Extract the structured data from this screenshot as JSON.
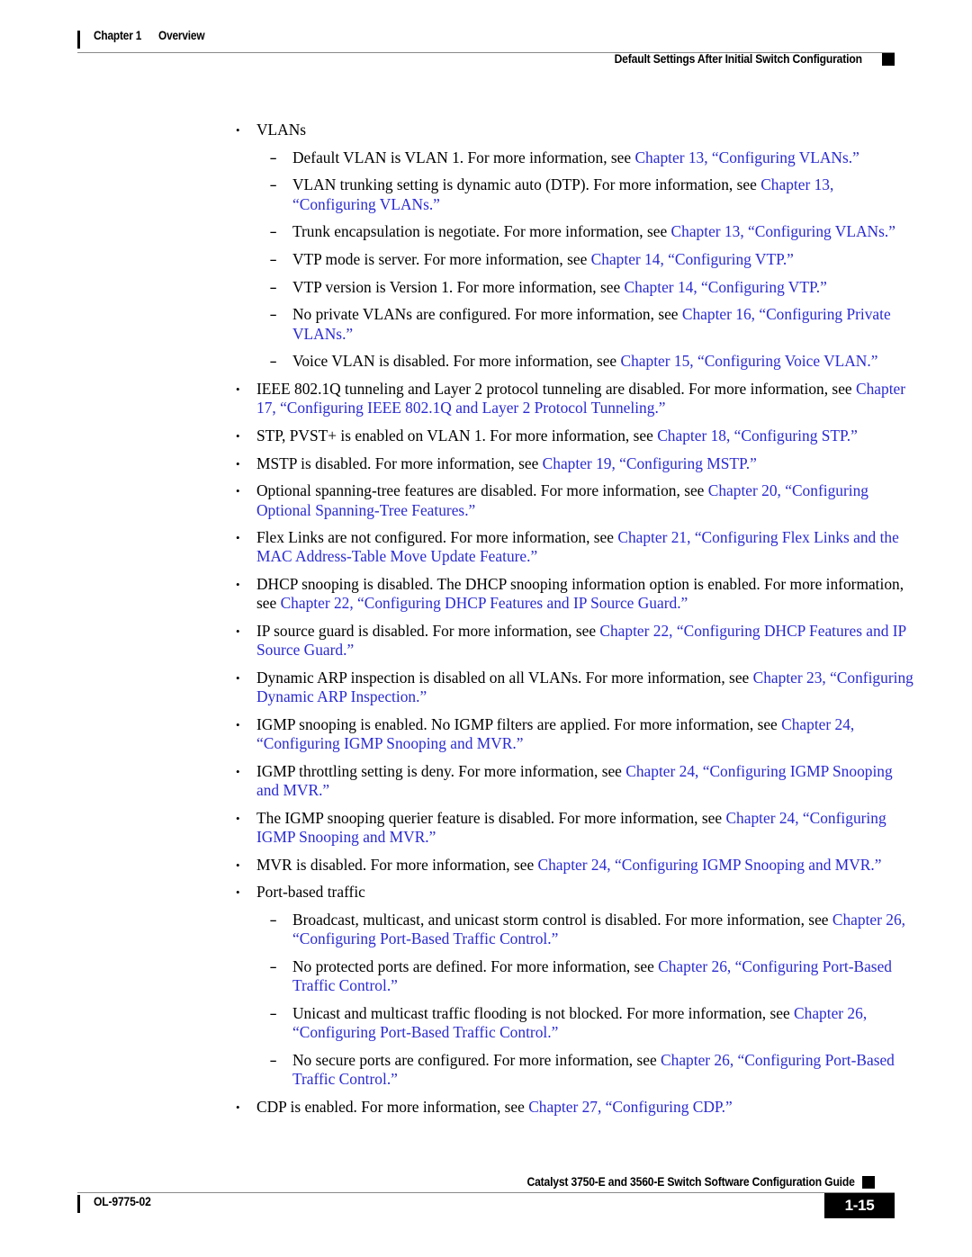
{
  "header": {
    "chapter": "Chapter 1",
    "chapter_title": "Overview",
    "section": "Default Settings After Initial Switch Configuration"
  },
  "footer": {
    "guide_title": "Catalyst 3750-E and 3560-E Switch Software Configuration Guide",
    "doc_id": "OL-9775-02",
    "page_number": "1-15"
  },
  "colors": {
    "link": "#2a2ad0",
    "text": "#000000",
    "rule": "#8a8a8a"
  },
  "markers": {
    "bullet_level1": "•",
    "bullet_level2": "–"
  },
  "body": {
    "items": [
      {
        "level": 1,
        "segments": [
          {
            "text": "VLANs",
            "link": false
          }
        ]
      },
      {
        "level": 2,
        "segments": [
          {
            "text": "Default VLAN is VLAN 1. For more information, see ",
            "link": false
          },
          {
            "text": "Chapter 13, “Configuring VLANs.”",
            "link": true
          }
        ]
      },
      {
        "level": 2,
        "segments": [
          {
            "text": "VLAN trunking setting is dynamic auto (DTP). For more information, see ",
            "link": false
          },
          {
            "text": "Chapter 13, “Configuring VLANs.”",
            "link": true
          }
        ]
      },
      {
        "level": 2,
        "segments": [
          {
            "text": "Trunk encapsulation is negotiate. For more information, see ",
            "link": false
          },
          {
            "text": "Chapter 13, “Configuring VLANs.”",
            "link": true
          }
        ]
      },
      {
        "level": 2,
        "segments": [
          {
            "text": "VTP mode is server. For more information, see ",
            "link": false
          },
          {
            "text": "Chapter 14, “Configuring VTP.”",
            "link": true
          }
        ]
      },
      {
        "level": 2,
        "segments": [
          {
            "text": "VTP version is Version 1. For more information, see ",
            "link": false
          },
          {
            "text": "Chapter 14, “Configuring VTP.”",
            "link": true
          }
        ]
      },
      {
        "level": 2,
        "segments": [
          {
            "text": "No private VLANs are configured. For more information, see ",
            "link": false
          },
          {
            "text": "Chapter 16, “Configuring Private VLANs.”",
            "link": true
          }
        ]
      },
      {
        "level": 2,
        "segments": [
          {
            "text": "Voice VLAN is disabled. For more information, see ",
            "link": false
          },
          {
            "text": "Chapter 15, “Configuring Voice VLAN.”",
            "link": true
          }
        ]
      },
      {
        "level": 1,
        "segments": [
          {
            "text": "IEEE 802.1Q tunneling and Layer 2 protocol tunneling are disabled. For more information, see ",
            "link": false
          },
          {
            "text": "Chapter 17, “Configuring IEEE 802.1Q and Layer 2 Protocol Tunneling.”",
            "link": true
          }
        ]
      },
      {
        "level": 1,
        "segments": [
          {
            "text": "STP, PVST+ is enabled on VLAN 1. For more information, see ",
            "link": false
          },
          {
            "text": "Chapter 18, “Configuring STP.”",
            "link": true
          }
        ]
      },
      {
        "level": 1,
        "segments": [
          {
            "text": "MSTP is disabled. For more information, see ",
            "link": false
          },
          {
            "text": "Chapter 19, “Configuring MSTP.”",
            "link": true
          }
        ]
      },
      {
        "level": 1,
        "segments": [
          {
            "text": "Optional spanning-tree features are disabled. For more information, see ",
            "link": false
          },
          {
            "text": "Chapter 20, “Configuring Optional Spanning-Tree Features.”",
            "link": true
          }
        ]
      },
      {
        "level": 1,
        "segments": [
          {
            "text": "Flex Links are not configured. For more information, see ",
            "link": false
          },
          {
            "text": "Chapter 21, “Configuring Flex Links and the MAC Address-Table Move Update Feature.”",
            "link": true
          }
        ]
      },
      {
        "level": 1,
        "segments": [
          {
            "text": "DHCP snooping is disabled. The DHCP snooping information option is enabled. For more information, see ",
            "link": false
          },
          {
            "text": "Chapter 22, “Configuring DHCP Features and IP Source Guard.”",
            "link": true
          }
        ]
      },
      {
        "level": 1,
        "segments": [
          {
            "text": "IP source guard is disabled. For more information, see ",
            "link": false
          },
          {
            "text": "Chapter 22, “Configuring DHCP Features and IP Source Guard.”",
            "link": true
          }
        ]
      },
      {
        "level": 1,
        "segments": [
          {
            "text": "Dynamic ARP inspection is disabled on all VLANs. For more information, see ",
            "link": false
          },
          {
            "text": "Chapter 23, “Configuring Dynamic ARP Inspection.”",
            "link": true
          }
        ]
      },
      {
        "level": 1,
        "segments": [
          {
            "text": "IGMP snooping is enabled. No IGMP filters are applied. For more information, see ",
            "link": false
          },
          {
            "text": "Chapter 24, “Configuring IGMP Snooping and MVR.”",
            "link": true
          }
        ]
      },
      {
        "level": 1,
        "segments": [
          {
            "text": "IGMP throttling setting is deny. For more information, see ",
            "link": false
          },
          {
            "text": "Chapter 24, “Configuring IGMP Snooping and MVR.”",
            "link": true
          }
        ]
      },
      {
        "level": 1,
        "segments": [
          {
            "text": "The IGMP snooping querier feature is disabled. For more information, see ",
            "link": false
          },
          {
            "text": "Chapter 24, “Configuring IGMP Snooping and MVR.”",
            "link": true
          }
        ]
      },
      {
        "level": 1,
        "segments": [
          {
            "text": "MVR is disabled. For more information, see ",
            "link": false
          },
          {
            "text": "Chapter 24, “Configuring IGMP Snooping and MVR.”",
            "link": true
          }
        ]
      },
      {
        "level": 1,
        "segments": [
          {
            "text": "Port-based traffic",
            "link": false
          }
        ]
      },
      {
        "level": 2,
        "segments": [
          {
            "text": "Broadcast, multicast, and unicast storm control is disabled. For more information, see ",
            "link": false
          },
          {
            "text": "Chapter 26, “Configuring Port-Based Traffic Control.”",
            "link": true
          }
        ]
      },
      {
        "level": 2,
        "segments": [
          {
            "text": "No protected ports are defined. For more information, see ",
            "link": false
          },
          {
            "text": "Chapter 26, “Configuring Port-Based Traffic Control.”",
            "link": true
          }
        ]
      },
      {
        "level": 2,
        "segments": [
          {
            "text": "Unicast and multicast traffic flooding is not blocked. For more information, see ",
            "link": false
          },
          {
            "text": "Chapter 26, “Configuring Port-Based Traffic Control.”",
            "link": true
          }
        ]
      },
      {
        "level": 2,
        "segments": [
          {
            "text": "No secure ports are configured. For more information, see ",
            "link": false
          },
          {
            "text": "Chapter 26, “Configuring Port-Based Traffic Control.”",
            "link": true
          }
        ]
      },
      {
        "level": 1,
        "segments": [
          {
            "text": "CDP is enabled. For more information, see ",
            "link": false
          },
          {
            "text": "Chapter 27, “Configuring CDP.”",
            "link": true
          }
        ]
      }
    ]
  }
}
